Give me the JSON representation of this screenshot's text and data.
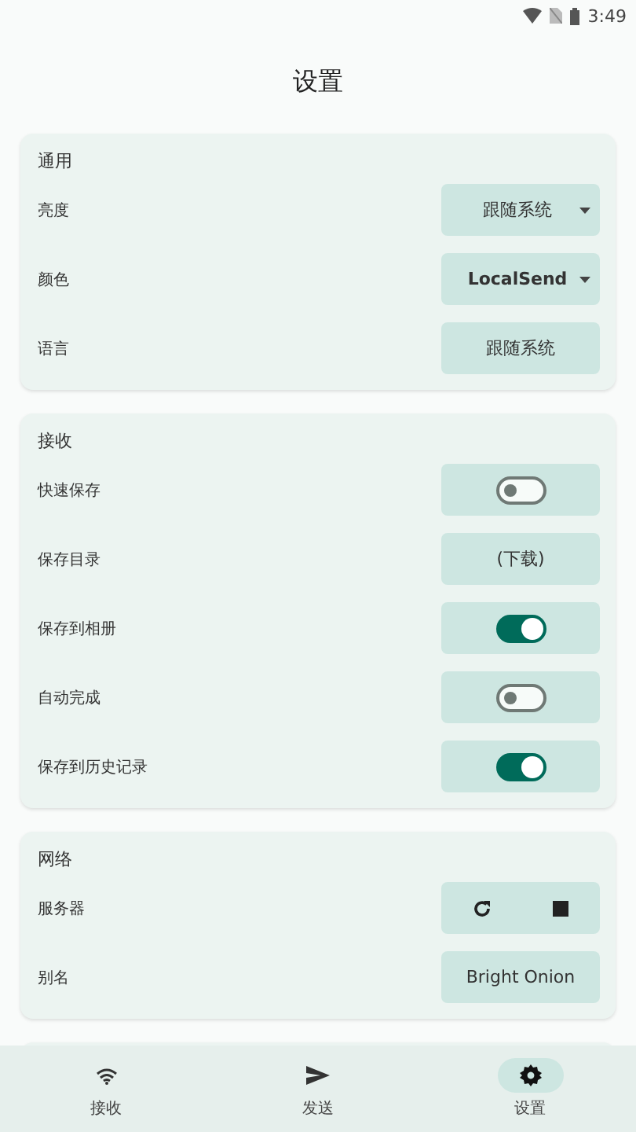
{
  "status_bar": {
    "time": "3:49"
  },
  "title": "设置",
  "sections": [
    {
      "title": "通用",
      "rows": [
        {
          "label": "亮度",
          "kind": "dropdown",
          "value": "跟随系统"
        },
        {
          "label": "颜色",
          "kind": "dropdown",
          "value": "LocalSend"
        },
        {
          "label": "语言",
          "kind": "button",
          "value": "跟随系统"
        }
      ]
    },
    {
      "title": "接收",
      "rows": [
        {
          "label": "快速保存",
          "kind": "switch",
          "on": false
        },
        {
          "label": "保存目录",
          "kind": "button",
          "value": "(下载)"
        },
        {
          "label": "保存到相册",
          "kind": "switch",
          "on": true
        },
        {
          "label": "自动完成",
          "kind": "switch",
          "on": false
        },
        {
          "label": "保存到历史记录",
          "kind": "switch",
          "on": true
        }
      ]
    },
    {
      "title": "网络",
      "rows": [
        {
          "label": "服务器",
          "kind": "server"
        },
        {
          "label": "别名",
          "kind": "button",
          "value": "Bright Onion"
        }
      ]
    }
  ],
  "nav": [
    {
      "label": "接收",
      "selected": false
    },
    {
      "label": "发送",
      "selected": false
    },
    {
      "label": "设置",
      "selected": true
    }
  ]
}
